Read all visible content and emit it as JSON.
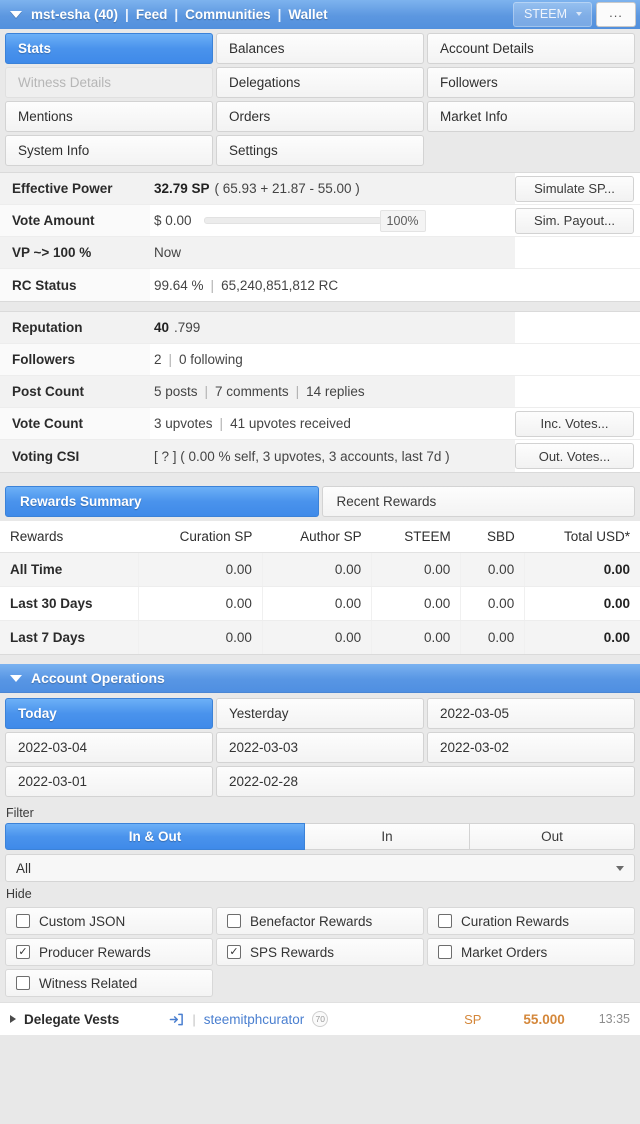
{
  "navbar": {
    "caret_icon": "caret-down-icon",
    "account": "mst-esha (40)",
    "links": [
      "Feed",
      "Communities",
      "Wallet"
    ],
    "separator": "|",
    "token_selector": "STEEM",
    "overflow_label": "...",
    "accent_color": "#5c97e0"
  },
  "menu": {
    "items": [
      {
        "label": "Stats",
        "state": "active"
      },
      {
        "label": "Balances",
        "state": "normal"
      },
      {
        "label": "Account Details",
        "state": "normal"
      },
      {
        "label": "Witness Details",
        "state": "disabled"
      },
      {
        "label": "Delegations",
        "state": "normal"
      },
      {
        "label": "Followers",
        "state": "normal"
      },
      {
        "label": "Mentions",
        "state": "normal"
      },
      {
        "label": "Orders",
        "state": "normal"
      },
      {
        "label": "Market Info",
        "state": "normal"
      },
      {
        "label": "System Info",
        "state": "normal"
      },
      {
        "label": "Settings",
        "state": "normal"
      },
      {
        "label": "",
        "state": "empty"
      }
    ]
  },
  "stats_top": {
    "rows": [
      {
        "label": "Effective Power",
        "value_strong": "32.79 SP",
        "value_rest": "( 65.93 + 21.87 - 55.00 )",
        "button": "Simulate SP..."
      },
      {
        "label": "Vote Amount",
        "value_strong": "",
        "value_rest": "$ 0.00",
        "slider_pct": "100%",
        "button": "Sim. Payout..."
      },
      {
        "label": "VP ~> 100 %",
        "value_strong": "",
        "value_rest": "Now",
        "button": ""
      },
      {
        "label": "RC Status",
        "value_strong": "",
        "value_rest": "99.64 %",
        "value_extra": "65,240,851,812 RC",
        "button": ""
      }
    ]
  },
  "stats_bottom": {
    "rows": [
      {
        "label": "Reputation",
        "value_strong": "40",
        "value_rest": ".799",
        "button": ""
      },
      {
        "label": "Followers",
        "value_strong": "",
        "value_rest": "2",
        "value_extra": "0 following",
        "button": ""
      },
      {
        "label": "Post Count",
        "value_strong": "",
        "value_rest": "5 posts",
        "value_extra": "7 comments",
        "value_extra2": "14 replies",
        "button": ""
      },
      {
        "label": "Vote Count",
        "value_strong": "",
        "value_rest": "3 upvotes",
        "value_extra": "41 upvotes received",
        "button": "Inc. Votes..."
      },
      {
        "label": "Voting CSI",
        "value_strong": "",
        "value_rest": "[ ? ] ( 0.00 % self, 3 upvotes, 3 accounts, last 7d )",
        "button": "Out. Votes..."
      }
    ]
  },
  "rewards": {
    "tabs": [
      {
        "label": "Rewards Summary",
        "state": "active"
      },
      {
        "label": "Recent Rewards",
        "state": "normal"
      }
    ],
    "table": {
      "headers": [
        "Rewards",
        "Curation SP",
        "Author SP",
        "STEEM",
        "SBD",
        "Total USD*"
      ],
      "rows": [
        {
          "period": "All Time",
          "curation_sp": "0.00",
          "author_sp": "0.00",
          "steem": "0.00",
          "sbd": "0.00",
          "total_usd": "0.00"
        },
        {
          "period": "Last 30 Days",
          "curation_sp": "0.00",
          "author_sp": "0.00",
          "steem": "0.00",
          "sbd": "0.00",
          "total_usd": "0.00"
        },
        {
          "period": "Last 7 Days",
          "curation_sp": "0.00",
          "author_sp": "0.00",
          "steem": "0.00",
          "sbd": "0.00",
          "total_usd": "0.00"
        }
      ]
    }
  },
  "account_operations": {
    "header": "Account Operations",
    "header_caret_icon": "caret-down-icon",
    "dates": [
      {
        "label": "Today",
        "state": "active",
        "wide": false
      },
      {
        "label": "Yesterday",
        "state": "normal",
        "wide": false
      },
      {
        "label": "2022-03-05",
        "state": "normal",
        "wide": false
      },
      {
        "label": "2022-03-04",
        "state": "normal",
        "wide": false
      },
      {
        "label": "2022-03-03",
        "state": "normal",
        "wide": false
      },
      {
        "label": "2022-03-02",
        "state": "normal",
        "wide": false
      },
      {
        "label": "2022-03-01",
        "state": "normal",
        "wide": false
      },
      {
        "label": "2022-02-28",
        "state": "normal",
        "wide": true
      }
    ],
    "filter_label": "Filter",
    "segments": [
      {
        "label": "In & Out",
        "state": "active"
      },
      {
        "label": "In",
        "state": "normal"
      },
      {
        "label": "Out",
        "state": "normal"
      }
    ],
    "select_value": "All",
    "hide_label": "Hide",
    "hide_options": [
      {
        "label": "Custom JSON",
        "checked": false
      },
      {
        "label": "Benefactor Rewards",
        "checked": false
      },
      {
        "label": "Curation Rewards",
        "checked": false
      },
      {
        "label": "Producer Rewards",
        "checked": true
      },
      {
        "label": "SPS Rewards",
        "checked": true
      },
      {
        "label": "Market Orders",
        "checked": false
      },
      {
        "label": "Witness Related",
        "checked": false
      }
    ],
    "operation_row": {
      "expand_icon": "caret-right-icon",
      "name": "Delegate Vests",
      "direction_icon": "arrow-into-bracket-icon",
      "pipe": "|",
      "user": "steemitphcurator",
      "user_reputation": "70",
      "unit": "SP",
      "amount": "55.000",
      "time": "13:35"
    }
  },
  "checkmark_glyph": "✓"
}
